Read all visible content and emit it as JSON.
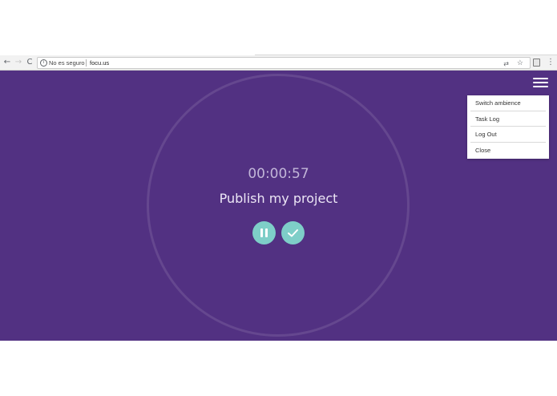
{
  "browser": {
    "back_icon": "←",
    "forward_icon": "→",
    "reload_icon": "C",
    "info_icon": "i",
    "security_label": "No es seguro",
    "url": "focu.us",
    "translate_icon": "⇄",
    "star_icon": "☆",
    "menu_icon": "⋮"
  },
  "app": {
    "background_color": "#523182",
    "accent_color": "#7ecec8",
    "timer": "00:00:57",
    "task_title": "Publish my project",
    "menu_items": [
      {
        "label": "Switch ambience"
      },
      {
        "label": "Task Log"
      },
      {
        "label": "Log Out"
      },
      {
        "label": "Close"
      }
    ]
  }
}
